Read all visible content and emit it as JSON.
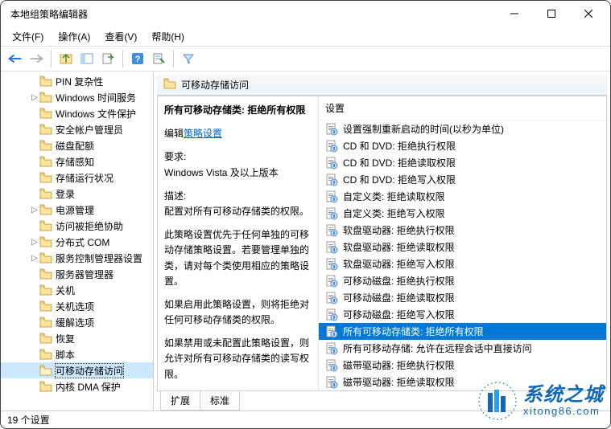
{
  "window": {
    "title": "本地组策略编辑器"
  },
  "menus": [
    "文件(F)",
    "操作(A)",
    "查看(V)",
    "帮助(H)"
  ],
  "tree": [
    {
      "label": "PIN 复杂性",
      "indent": 36
    },
    {
      "label": "Windows 时间服务",
      "indent": 36,
      "expandable": true
    },
    {
      "label": "Windows 文件保护",
      "indent": 36
    },
    {
      "label": "安全帐户管理员",
      "indent": 36
    },
    {
      "label": "磁盘配额",
      "indent": 36
    },
    {
      "label": "存储感知",
      "indent": 36
    },
    {
      "label": "存储运行状况",
      "indent": 36
    },
    {
      "label": "登录",
      "indent": 36
    },
    {
      "label": "电源管理",
      "indent": 36,
      "expandable": true
    },
    {
      "label": "访问被拒绝协助",
      "indent": 36
    },
    {
      "label": "分布式 COM",
      "indent": 36,
      "expandable": true
    },
    {
      "label": "服务控制管理器设置",
      "indent": 36,
      "expandable": true
    },
    {
      "label": "服务器管理器",
      "indent": 36
    },
    {
      "label": "关机",
      "indent": 36
    },
    {
      "label": "关机选项",
      "indent": 36
    },
    {
      "label": "缓解选项",
      "indent": 36
    },
    {
      "label": "恢复",
      "indent": 36
    },
    {
      "label": "脚本",
      "indent": 36
    },
    {
      "label": "可移动存储访问",
      "indent": 36,
      "selected": true
    },
    {
      "label": "内核 DMA 保护",
      "indent": 36
    }
  ],
  "details": {
    "header": "可移动存储访问",
    "policy_title": "所有可移动存储类: 拒绝所有权限",
    "edit_link_prefix": "编辑",
    "edit_link": "策略设置",
    "req_label": "要求:",
    "req_value": "Windows Vista 及以上版本",
    "desc_label": "描述:",
    "desc_value": "配置对所有可移动存储类的权限。",
    "para1": "此策略设置优先于任何单独的可移动存储策略设置。若要管理单独的类，请对每个类使用相应的策略设置。",
    "para2": "如果启用此策略设置，则将拒绝对任何可移动存储类的权限。",
    "para3": "如果禁用或未配置此策略设置，则允许对所有可移动存储类的读写权限。"
  },
  "settings_header": "设置",
  "settings": [
    {
      "label": "设置强制重新启动的时间(以秒为单位)"
    },
    {
      "label": "CD 和 DVD: 拒绝执行权限"
    },
    {
      "label": "CD 和 DVD: 拒绝读取权限"
    },
    {
      "label": "CD 和 DVD: 拒绝写入权限"
    },
    {
      "label": "自定义类: 拒绝读取权限"
    },
    {
      "label": "自定义类: 拒绝写入权限"
    },
    {
      "label": "软盘驱动器: 拒绝执行权限"
    },
    {
      "label": "软盘驱动器: 拒绝读取权限"
    },
    {
      "label": "软盘驱动器: 拒绝写入权限"
    },
    {
      "label": "可移动磁盘: 拒绝执行权限"
    },
    {
      "label": "可移动磁盘: 拒绝读取权限"
    },
    {
      "label": "可移动磁盘: 拒绝写入权限"
    },
    {
      "label": "所有可移动存储类: 拒绝所有权限",
      "selected": true
    },
    {
      "label": "所有可移动存储: 允许在远程会话中直接访问"
    },
    {
      "label": "磁带驱动器: 拒绝执行权限"
    },
    {
      "label": "磁带驱动器: 拒绝读取权限"
    }
  ],
  "tabs": [
    "扩展",
    "标准"
  ],
  "status": "19 个设置",
  "watermark": {
    "cn": "系统之城",
    "url": "xitong86.com"
  }
}
